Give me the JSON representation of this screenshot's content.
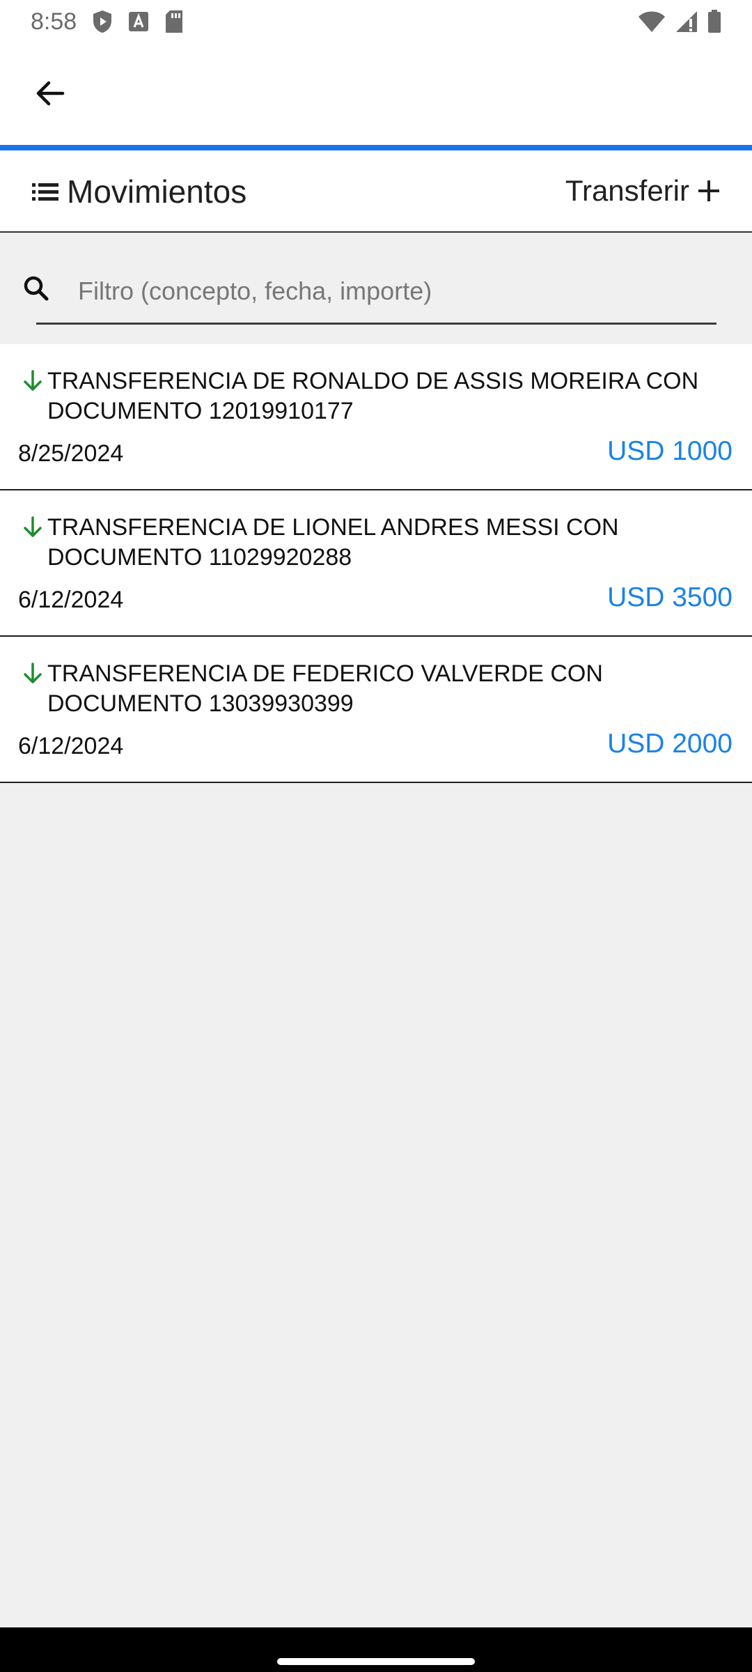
{
  "status_bar": {
    "time": "8:58"
  },
  "header": {
    "title": "Movimientos",
    "transfer_label": "Transferir"
  },
  "search": {
    "placeholder": "Filtro (concepto, fecha, importe)",
    "value": ""
  },
  "movements": [
    {
      "description": "TRANSFERENCIA DE RONALDO DE ASSIS MOREIRA CON DOCUMENTO 12019910177",
      "date": "8/25/2024",
      "amount": "USD 1000"
    },
    {
      "description": "TRANSFERENCIA DE LIONEL ANDRES MESSI CON DOCUMENTO 11029920288",
      "date": "6/12/2024",
      "amount": "USD 3500"
    },
    {
      "description": "TRANSFERENCIA DE FEDERICO VALVERDE CON DOCUMENTO 13039930399",
      "date": "6/12/2024",
      "amount": "USD 2000"
    }
  ],
  "icons": {
    "back": "arrow-back-icon",
    "list": "list-icon",
    "add": "plus-icon",
    "search": "search-icon",
    "incoming": "arrow-down-icon"
  },
  "colors": {
    "accent": "#1a73e8",
    "amount": "#1a82e6",
    "incoming_arrow": "#1e8c2e"
  }
}
